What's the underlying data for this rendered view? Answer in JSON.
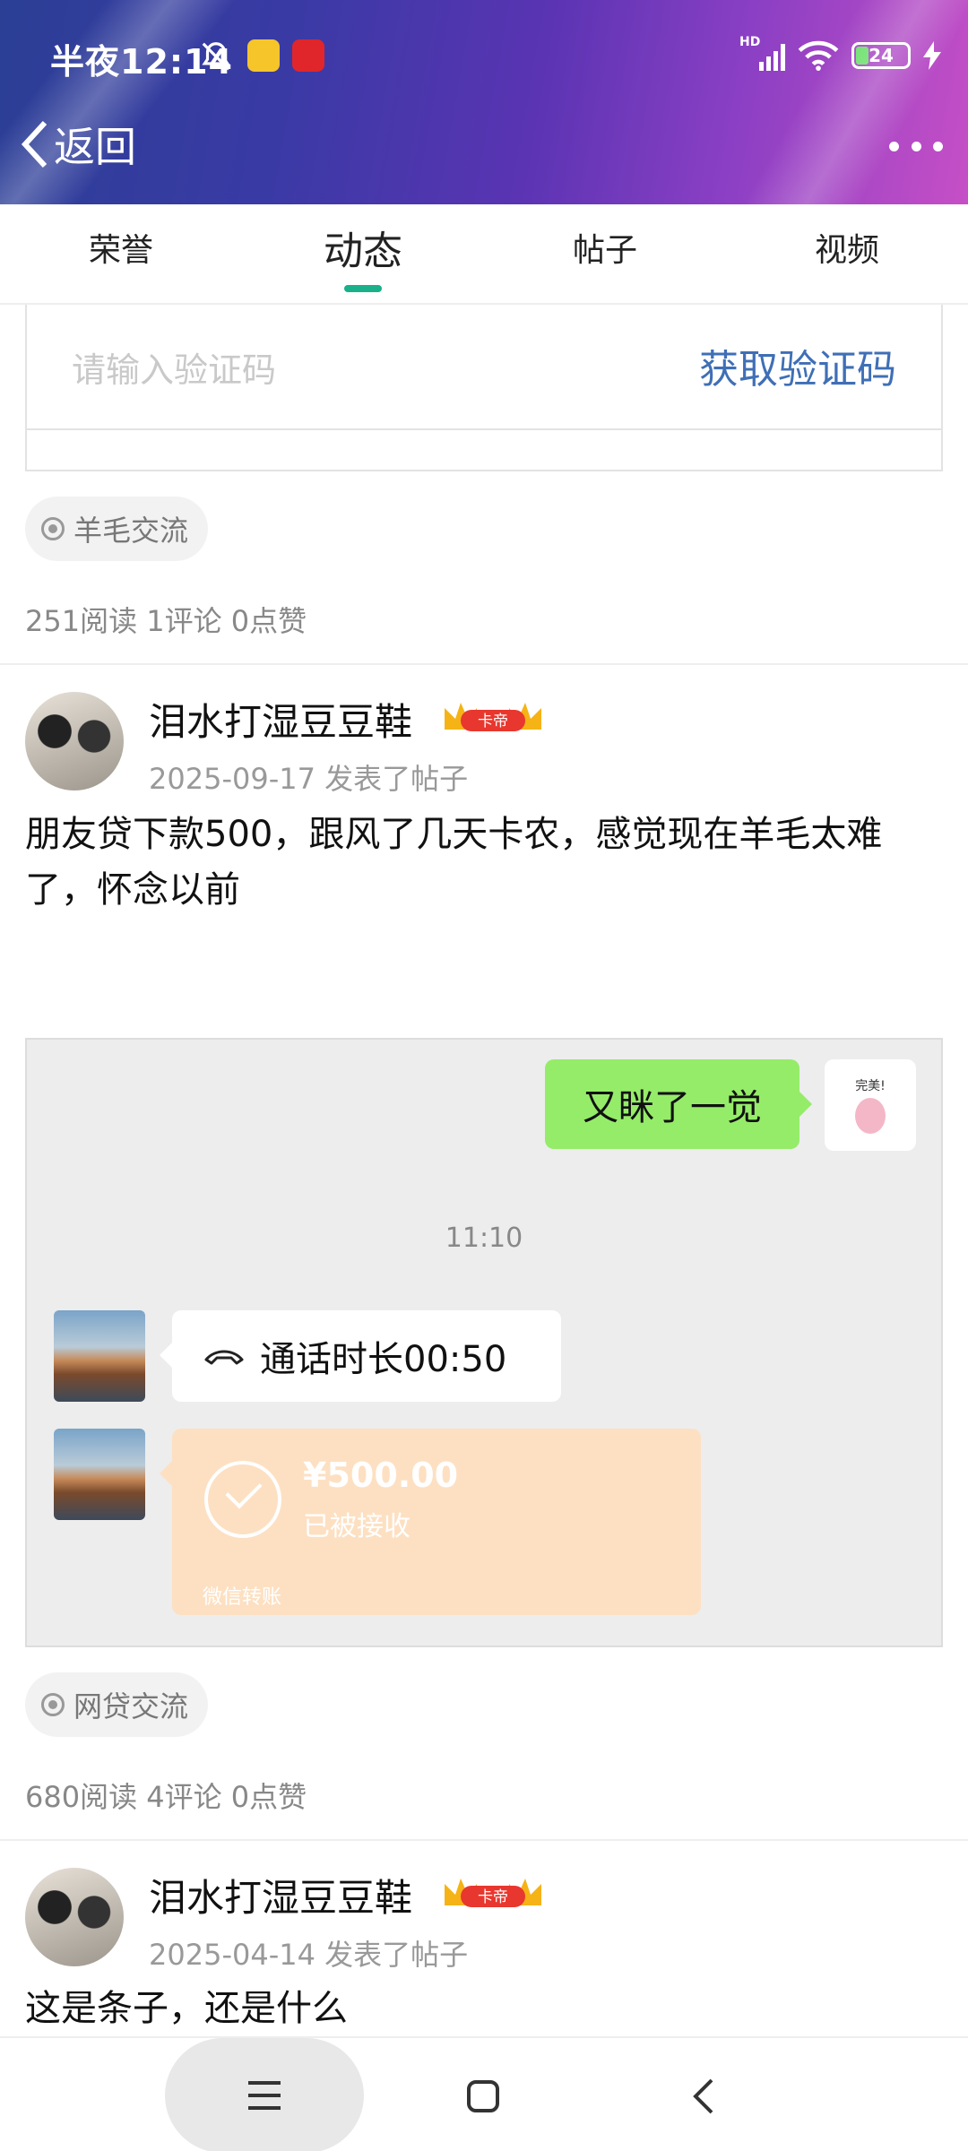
{
  "status_bar": {
    "time": "半夜12:14",
    "network": "HD",
    "battery": "24",
    "icons": [
      "bell-off-icon",
      "app-notification-icon",
      "app-notification-icon",
      "signal-icon",
      "wifi-icon",
      "battery-icon",
      "charging-icon"
    ]
  },
  "navbar": {
    "back_label": "返回",
    "more_icon": "more-dots-icon"
  },
  "tabs": [
    {
      "label": "荣誉",
      "active": false
    },
    {
      "label": "动态",
      "active": true
    },
    {
      "label": "帖子",
      "active": false
    },
    {
      "label": "视频",
      "active": false
    }
  ],
  "accent_color": "#19b08a",
  "verify": {
    "placeholder": "请输入验证码",
    "button_label": "获取验证码"
  },
  "post0": {
    "tag": "羊毛交流",
    "stats": "251阅读 1评论 0点赞"
  },
  "post1": {
    "author": "泪水打湿豆豆鞋",
    "badge": "卡帝",
    "meta": "2025-09-17 发表了帖子",
    "text": "朋友贷下款500，跟风了几天卡农，感觉现在羊毛太难了，怀念以前",
    "image": {
      "green_bubble": "又眯了一觉",
      "sticker_text": "完美!",
      "time": "11:10",
      "call_text": "通话时长00:50",
      "transfer_amount": "¥500.00",
      "transfer_status": "已被接收",
      "transfer_label": "微信转账"
    },
    "tag": "网贷交流",
    "stats": "680阅读 4评论 0点赞"
  },
  "post2": {
    "author": "泪水打湿豆豆鞋",
    "badge": "卡帝",
    "meta": "2025-04-14 发表了帖子",
    "text": "这是条子，还是什么"
  },
  "bottom_nav": {
    "icons": [
      "menu-icon",
      "home-icon",
      "back-icon"
    ]
  }
}
